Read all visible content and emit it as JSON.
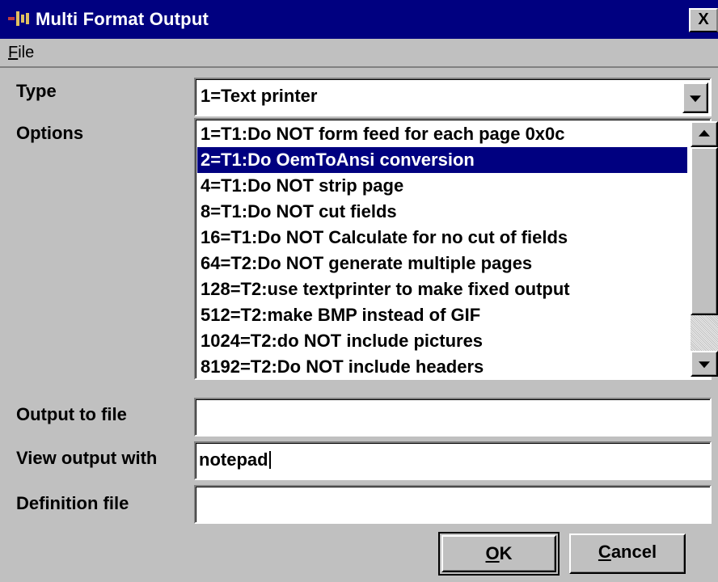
{
  "window": {
    "title": "Multi Format Output",
    "close_label": "X"
  },
  "menu": {
    "file_label": "File",
    "file_accel": "F",
    "file_rest": "ile"
  },
  "fields": {
    "type_label": "Type",
    "type_value": "1=Text printer",
    "options_label": "Options",
    "output_to_file_label": "Output to file",
    "output_to_file_value": "",
    "view_output_label": "View output with",
    "view_output_value": "notepad",
    "definition_file_label": "Definition file",
    "definition_file_value": ""
  },
  "options": {
    "items": [
      "1=T1:Do NOT form feed for each page 0x0c",
      "2=T1:Do OemToAnsi conversion",
      "4=T1:Do NOT strip page",
      "8=T1:Do NOT cut fields",
      "16=T1:Do NOT Calculate for no cut of fields",
      "64=T2:Do NOT generate multiple pages",
      "128=T2:use textprinter to make fixed output",
      "512=T2:make BMP instead of GIF",
      "1024=T2:do NOT include pictures",
      "8192=T2:Do NOT include headers"
    ],
    "selected_index": 1
  },
  "buttons": {
    "ok_accel": "O",
    "ok_rest": "K",
    "cancel_accel": "C",
    "cancel_rest": "ancel"
  },
  "colors": {
    "titlebar": "#000080",
    "selection": "#000080",
    "face": "#c0c0c0"
  }
}
